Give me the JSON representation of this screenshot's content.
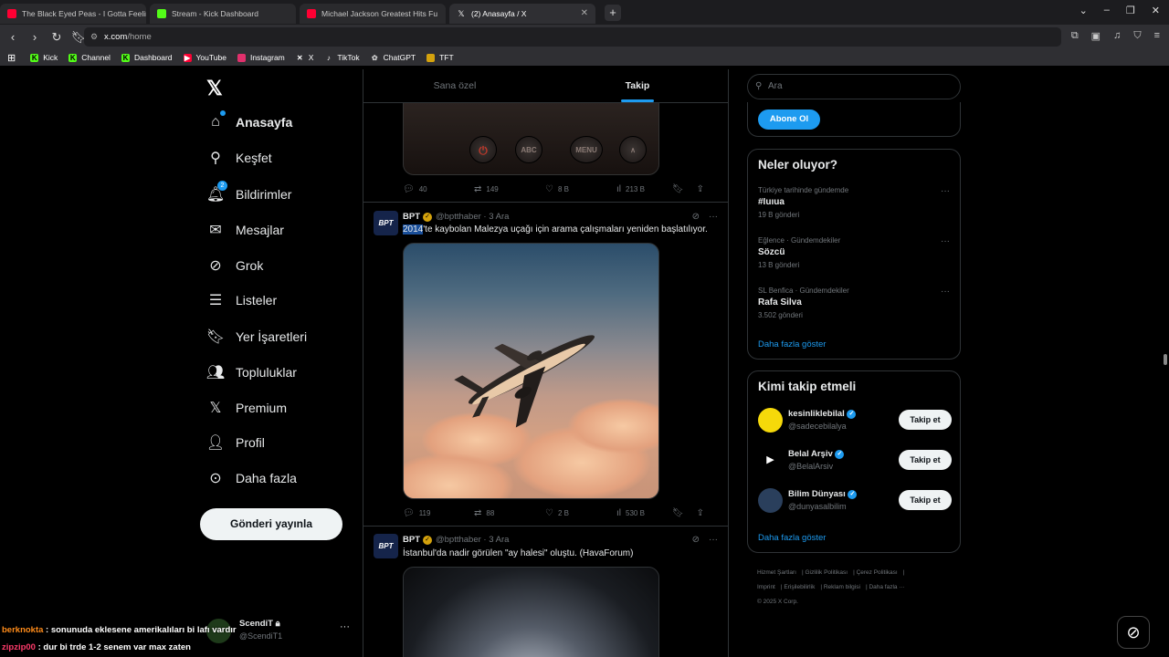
{
  "browser": {
    "tabs": [
      {
        "title": "The Black Eyed Peas - I Gotta Feeling",
        "favicon_color": "#ff0033"
      },
      {
        "title": "Stream - Kick Dashboard",
        "favicon_color": "#53fc18"
      },
      {
        "title": "Michael Jackson Greatest Hits Fu",
        "favicon_color": "#ff0033"
      },
      {
        "title": "(2) Anasayfa / X",
        "favicon_color": "#ffffff",
        "active": true
      }
    ],
    "url_host": "x.com",
    "url_path": "/home",
    "bookmarks": [
      {
        "label": "Kick",
        "color": "#53fc18"
      },
      {
        "label": "Channel",
        "color": "#53fc18"
      },
      {
        "label": "Dashboard",
        "color": "#53fc18"
      },
      {
        "label": "YouTube",
        "color": "#ff0033"
      },
      {
        "label": "Instagram",
        "color": "#e1306c"
      },
      {
        "label": "X",
        "color": "#ffffff"
      },
      {
        "label": "TikTok",
        "color": "#ffffff"
      },
      {
        "label": "ChatGPT",
        "color": "#cccccc"
      },
      {
        "label": "TFT",
        "color": "#d4a20d"
      }
    ]
  },
  "nav": {
    "items": [
      {
        "label": "Anasayfa",
        "icon": "home-icon"
      },
      {
        "label": "Keşfet",
        "icon": "search-icon"
      },
      {
        "label": "Bildirimler",
        "icon": "bell-icon",
        "badge": "2"
      },
      {
        "label": "Mesajlar",
        "icon": "mail-icon"
      },
      {
        "label": "Grok",
        "icon": "grok-icon"
      },
      {
        "label": "Listeler",
        "icon": "list-icon"
      },
      {
        "label": "Yer İşaretleri",
        "icon": "bookmark-icon"
      },
      {
        "label": "Topluluklar",
        "icon": "communities-icon"
      },
      {
        "label": "Premium",
        "icon": "x-icon"
      },
      {
        "label": "Profil",
        "icon": "profile-icon"
      },
      {
        "label": "Daha fazla",
        "icon": "more-circle-icon"
      }
    ],
    "post_button": "Gönderi yayınla",
    "account": {
      "name": "ScendiT",
      "handle": "@ScendiT1"
    }
  },
  "feed": {
    "tabs": [
      "Sana özel",
      "Takip"
    ],
    "active_tab": "Takip",
    "first_post_remote_buttons": [
      "ABC",
      "MENU"
    ],
    "first_post_stats": {
      "replies": "40",
      "reposts": "149",
      "likes": "8 B",
      "views": "213 B"
    },
    "posts": [
      {
        "name": "BPT",
        "handle": "@bptthaber",
        "date": "3 Ara",
        "avatar_text": "BPT",
        "text_highlight": "2014",
        "text": "'te kaybolan Malezya uçağı için arama çalışmaları yeniden başlatılıyor.",
        "stats": {
          "replies": "119",
          "reposts": "88",
          "likes": "2 B",
          "views": "530 B"
        }
      },
      {
        "name": "BPT",
        "handle": "@bptthaber",
        "date": "3 Ara",
        "avatar_text": "BPT",
        "text": "İstanbul'da nadir görülen \"ay halesi\" oluştu. (HavaForum)"
      }
    ]
  },
  "sidebar": {
    "search_placeholder": "Ara",
    "subscribe_button": "Abone Ol",
    "trends_title": "Neler oluyor?",
    "trends": [
      {
        "context": "Türkiye tarihinde gündemde",
        "title": "#Iuıua",
        "count": "19 B gönderi"
      },
      {
        "context": "Eğlence · Gündemdekiler",
        "title": "Sözcü",
        "count": "13 B gönderi"
      },
      {
        "context": "SL Benfica · Gündemdekiler",
        "title": "Rafa Silva",
        "count": "3.502 gönderi"
      }
    ],
    "show_more": "Daha fazla göster",
    "who_to_follow_title": "Kimi takip etmeli",
    "who_to_follow": [
      {
        "name": "kesinliklebilal",
        "handle": "@sadecebilalya",
        "color": "#f5d90a"
      },
      {
        "name": "Belal Arşiv",
        "handle": "@BelalArsiv",
        "color": "#000000"
      },
      {
        "name": "Bilim Dünyası",
        "handle": "@dunyasalbilim",
        "color": "#2a3f5c"
      }
    ],
    "follow_button": "Takip et",
    "footer_links": [
      "Hizmet Şartları",
      "Gizlilik Politikası",
      "Çerez Politikası",
      "Imprint",
      "Erişilebilirlik",
      "Reklam bilgisi",
      "Daha fazla ···"
    ],
    "copyright": "© 2025 X Corp."
  },
  "chat_overlay": [
    {
      "user": "berknokta",
      "user_color": "#ff8c1a",
      "message": " : sonunuda eklesene amerikalıları bi lafı vardır"
    },
    {
      "user": "zipzip00",
      "user_color": "#ff3b6b",
      "message": " : dur bi trde 1-2 senem var max zaten"
    }
  ]
}
